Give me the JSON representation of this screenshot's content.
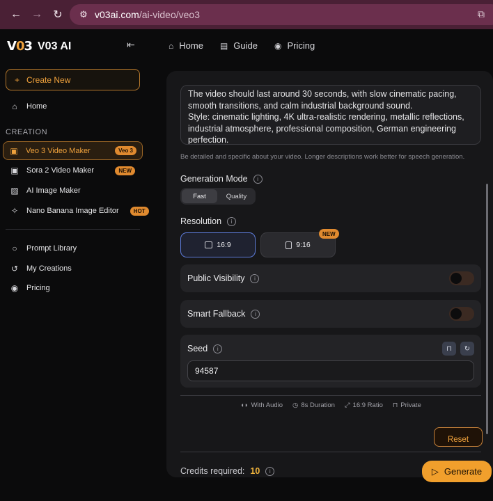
{
  "browser": {
    "url_host": "v03ai.com",
    "url_path": "/ai-video/veo3"
  },
  "brand": {
    "logo": "V03",
    "name": "V03 AI"
  },
  "sidebar": {
    "create_label": "Create New",
    "home_label": "Home",
    "section_label": "CREATION",
    "items": [
      {
        "label": "Veo 3 Video Maker",
        "badge": "Veo 3"
      },
      {
        "label": "Sora 2 Video Maker",
        "badge": "NEW"
      },
      {
        "label": "AI Image Maker",
        "badge": ""
      },
      {
        "label": "Nano Banana Image Editor",
        "badge": "HOT"
      }
    ],
    "lower": [
      {
        "label": "Prompt Library"
      },
      {
        "label": "My Creations"
      },
      {
        "label": "Pricing"
      }
    ]
  },
  "topnav": [
    {
      "label": "Home"
    },
    {
      "label": "Guide"
    },
    {
      "label": "Pricing"
    }
  ],
  "form": {
    "description_lines": [
      "The video should last around 30 seconds, with slow cinematic pacing,",
      "smooth transitions, and calm industrial background sound.",
      "Style: cinematic lighting, 4K ultra-realistic rendering, metallic reflections,",
      "industrial atmosphere, professional composition, German engineering",
      "perfection."
    ],
    "hint": "Be detailed and specific about your video. Longer descriptions work better for speech generation.",
    "generation_mode": {
      "title": "Generation Mode",
      "options": [
        "Fast",
        "Quality"
      ],
      "selected": "Fast"
    },
    "resolution": {
      "title": "Resolution",
      "options": [
        "16:9",
        "9:16"
      ],
      "selected": "16:9",
      "new_tag": "NEW"
    },
    "public_visibility": {
      "title": "Public Visibility",
      "enabled": false
    },
    "smart_fallback": {
      "title": "Smart Fallback",
      "enabled": false
    },
    "seed": {
      "title": "Seed",
      "value": "94587"
    },
    "meta": {
      "audio": "With Audio",
      "duration": "8s Duration",
      "ratio": "16:9 Ratio",
      "privacy": "Private"
    },
    "reset_label": "Reset",
    "credits_label": "Credits required:",
    "credits_value": "10",
    "generate_label": "Generate"
  }
}
